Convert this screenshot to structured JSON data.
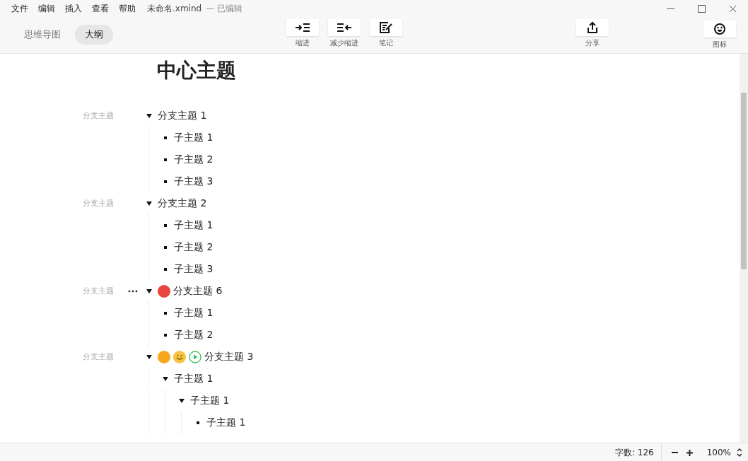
{
  "menu": [
    "文件",
    "编辑",
    "插入",
    "查看",
    "帮助"
  ],
  "window": {
    "title": "未命名.xmind",
    "status": "— 已编辑"
  },
  "view_tabs": [
    {
      "label": "思维导图",
      "selected": false
    },
    {
      "label": "大纲",
      "selected": true
    }
  ],
  "toolbar": [
    {
      "kind": "indent",
      "label": "缩进"
    },
    {
      "kind": "outdent",
      "label": "减少缩进"
    },
    {
      "kind": "note",
      "label": "笔记"
    }
  ],
  "share": {
    "label": "分享"
  },
  "icons_button": {
    "label": "图标"
  },
  "outline": {
    "title": "中心主题",
    "branches": [
      {
        "tag": "分支主题",
        "text": "分支主题 1",
        "expanded": true,
        "more": false,
        "children": [
          {
            "text": "子主题 1"
          },
          {
            "text": "子主题 2"
          },
          {
            "text": "子主题 3"
          }
        ]
      },
      {
        "tag": "分支主题",
        "text": "分支主题 2",
        "expanded": true,
        "more": false,
        "children": [
          {
            "text": "子主题 1"
          },
          {
            "text": "子主题 2"
          },
          {
            "text": "子主题 3"
          }
        ]
      },
      {
        "tag": "分支主题",
        "text": "分支主题 6",
        "expanded": true,
        "more": true,
        "markers": [
          {
            "kind": "dot",
            "color": "#e8453c"
          }
        ],
        "children": [
          {
            "text": "子主题 1"
          },
          {
            "text": "子主题 2"
          }
        ]
      },
      {
        "tag": "分支主题",
        "text": "分支主题 3",
        "expanded": true,
        "more": false,
        "markers": [
          {
            "kind": "dot",
            "color": "#f5a81c"
          },
          {
            "kind": "smiley"
          },
          {
            "kind": "play"
          }
        ],
        "children": [
          {
            "text": "子主题 1",
            "expanded": true,
            "children": [
              {
                "text": "子主题 1",
                "expanded": true,
                "children": [
                  {
                    "text": "子主题 1"
                  }
                ]
              }
            ]
          }
        ]
      }
    ]
  },
  "status_bar": {
    "word_count": "字数: 126",
    "zoom": "100%"
  }
}
